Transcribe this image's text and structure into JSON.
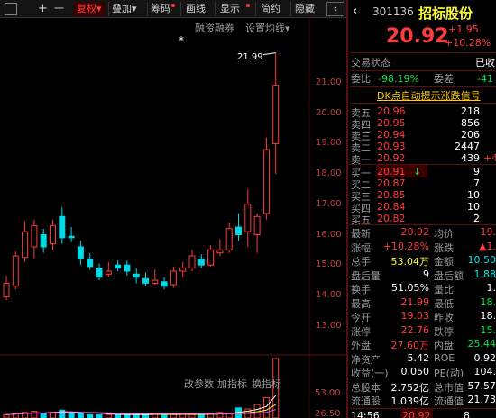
{
  "toolbar": {
    "grid_icon": "grid-icon",
    "plus": "+",
    "minus": "一",
    "fuquan_label": "复权",
    "fuquan_arrow": "▾",
    "diejia_label": "叠加",
    "diejia_arrow": "▾",
    "chouma_label": "筹码",
    "huaxian_label": "画线",
    "xianshi_label": "显示",
    "jianyue_label": "简约",
    "yincang_label": "隐藏"
  },
  "chart_header": {
    "rongzi_label": "融资融券",
    "ma_setting_label": "设置均线",
    "ma_arrow": "▾"
  },
  "price_axis": {
    "ticks": [
      "21.00",
      "20.00",
      "19.00",
      "18.00",
      "17.00",
      "16.00",
      "15.00",
      "14.00",
      "13.00"
    ]
  },
  "high_marker": {
    "value": "21.99",
    "star": "*"
  },
  "indicator_toolbar": {
    "param_label": "改参数",
    "add_label": "加指标",
    "change_label": "换指标"
  },
  "volume_axis": {
    "ticks": [
      "53.00",
      "26.50"
    ]
  },
  "quote": {
    "code": "301136",
    "name": "招标股份",
    "price": "20.92",
    "change": "+1.95",
    "change_pct": "+10.28%",
    "status_label": "交易状态",
    "status_value": "已收",
    "weibi_label": "委比",
    "weibi_value": "-98.19%",
    "weicha_label": "委差",
    "weicha_value": "-41",
    "signal_label": "DK点自动提示涨跌信号",
    "asks": [
      {
        "label": "卖五",
        "price": "20.96",
        "vol": "218",
        "mark": ""
      },
      {
        "label": "卖四",
        "price": "20.95",
        "vol": "856",
        "mark": ""
      },
      {
        "label": "卖三",
        "price": "20.94",
        "vol": "206",
        "mark": ""
      },
      {
        "label": "卖二",
        "price": "20.93",
        "vol": "2447",
        "mark": ""
      },
      {
        "label": "卖一",
        "price": "20.92",
        "vol": "439",
        "mark": "+4"
      }
    ],
    "bids": [
      {
        "label": "买一",
        "price": "20.91",
        "arrow": "↓",
        "vol": "9"
      },
      {
        "label": "买二",
        "price": "20.87",
        "arrow": "",
        "vol": "7"
      },
      {
        "label": "买三",
        "price": "20.85",
        "arrow": "",
        "vol": "10"
      },
      {
        "label": "买四",
        "price": "20.84",
        "arrow": "",
        "vol": "10"
      },
      {
        "label": "买五",
        "price": "20.82",
        "arrow": "",
        "vol": "2"
      }
    ],
    "stats": [
      {
        "l1": "最新",
        "v1": "20.92",
        "c1": "red",
        "l2": "均价",
        "v2": "19.",
        "c2": "red"
      },
      {
        "l1": "涨幅",
        "v1": "+10.28%",
        "c1": "red",
        "l2": "涨跌",
        "v2": "▲1.",
        "c2": "red"
      },
      {
        "l1": "总手",
        "v1": "53.04万",
        "c1": "yel",
        "l2": "金额",
        "v2": "10.50",
        "c2": "cyn"
      },
      {
        "l1": "盘后量",
        "v1": "9",
        "c1": "wht",
        "l2": "盘后额",
        "v2": "1.88",
        "c2": "cyn"
      },
      {
        "l1": "换手",
        "v1": "51.05%",
        "c1": "wht",
        "l2": "量比",
        "v2": "1.",
        "c2": "wht"
      },
      {
        "l1": "最高",
        "v1": "21.99",
        "c1": "red",
        "l2": "最低",
        "v2": "18.",
        "c2": "grn"
      },
      {
        "l1": "今开",
        "v1": "19.03",
        "c1": "red",
        "l2": "昨收",
        "v2": "18.",
        "c2": "wht"
      },
      {
        "l1": "涨停",
        "v1": "22.76",
        "c1": "red",
        "l2": "跌停",
        "v2": "15.",
        "c2": "grn"
      },
      {
        "l1": "外盘",
        "v1": "27.60万",
        "c1": "red",
        "l2": "内盘",
        "v2": "25.44",
        "c2": "grn"
      },
      {
        "l1": "净资产",
        "v1": "5.42",
        "c1": "wht",
        "l2": "ROE",
        "v2": "0.92",
        "c2": "wht"
      },
      {
        "l1": "收益(一)",
        "v1": "0.050",
        "c1": "wht",
        "l2": "PE(动)",
        "v2": "104.",
        "c2": "wht"
      },
      {
        "l1": "总股本",
        "v1": "2.752亿",
        "c1": "wht",
        "l2": "总市值",
        "v2": "57.57",
        "c2": "wht"
      },
      {
        "l1": "流通股",
        "v1": "1.039亿",
        "c1": "wht",
        "l2": "流通值",
        "v2": "21.73",
        "c2": "wht"
      }
    ],
    "tick_time": "14:56",
    "tick_price": "20.92",
    "tick_vol": "8"
  },
  "chart_data": {
    "type": "candlestick",
    "ylim": [
      13.0,
      22.0
    ],
    "candles": [
      {
        "o": 13.95,
        "c": 14.4,
        "h": 14.65,
        "l": 13.85,
        "up": true
      },
      {
        "o": 14.3,
        "c": 15.3,
        "h": 15.45,
        "l": 14.2,
        "up": true
      },
      {
        "o": 15.25,
        "c": 16.1,
        "h": 16.45,
        "l": 15.1,
        "up": true
      },
      {
        "o": 15.6,
        "c": 16.3,
        "h": 16.5,
        "l": 15.2,
        "up": true
      },
      {
        "o": 16.0,
        "c": 15.6,
        "h": 16.2,
        "l": 15.4,
        "up": false
      },
      {
        "o": 15.7,
        "c": 16.3,
        "h": 16.5,
        "l": 15.5,
        "up": true
      },
      {
        "o": 16.6,
        "c": 15.9,
        "h": 16.9,
        "l": 15.7,
        "up": false
      },
      {
        "o": 15.95,
        "c": 15.9,
        "h": 16.25,
        "l": 15.75,
        "up": false
      },
      {
        "o": 15.6,
        "c": 15.2,
        "h": 15.8,
        "l": 15.0,
        "up": false
      },
      {
        "o": 15.2,
        "c": 14.95,
        "h": 15.4,
        "l": 14.85,
        "up": false
      },
      {
        "o": 14.9,
        "c": 14.6,
        "h": 15.05,
        "l": 14.5,
        "up": false
      },
      {
        "o": 14.7,
        "c": 14.8,
        "h": 15.1,
        "l": 14.6,
        "up": true
      },
      {
        "o": 15.0,
        "c": 14.9,
        "h": 15.15,
        "l": 14.8,
        "up": false
      },
      {
        "o": 15.0,
        "c": 14.8,
        "h": 15.15,
        "l": 14.65,
        "up": false
      },
      {
        "o": 14.7,
        "c": 14.6,
        "h": 14.9,
        "l": 14.4,
        "up": false
      },
      {
        "o": 14.55,
        "c": 14.4,
        "h": 14.75,
        "l": 14.3,
        "up": false
      },
      {
        "o": 14.4,
        "c": 14.5,
        "h": 14.85,
        "l": 14.35,
        "up": true
      },
      {
        "o": 14.45,
        "c": 14.3,
        "h": 14.6,
        "l": 14.2,
        "up": false
      },
      {
        "o": 14.35,
        "c": 14.8,
        "h": 14.95,
        "l": 14.25,
        "up": true
      },
      {
        "o": 14.8,
        "c": 14.9,
        "h": 15.1,
        "l": 14.6,
        "up": true
      },
      {
        "o": 14.9,
        "c": 15.3,
        "h": 15.5,
        "l": 14.8,
        "up": true
      },
      {
        "o": 15.2,
        "c": 15.0,
        "h": 15.35,
        "l": 14.9,
        "up": false
      },
      {
        "o": 15.0,
        "c": 15.5,
        "h": 15.65,
        "l": 14.95,
        "up": true
      },
      {
        "o": 15.4,
        "c": 15.5,
        "h": 15.85,
        "l": 15.3,
        "up": true
      },
      {
        "o": 15.5,
        "c": 16.2,
        "h": 16.4,
        "l": 15.4,
        "up": true
      },
      {
        "o": 16.25,
        "c": 16.0,
        "h": 16.7,
        "l": 15.8,
        "up": false
      },
      {
        "o": 16.1,
        "c": 17.0,
        "h": 17.5,
        "l": 15.6,
        "up": true
      },
      {
        "o": 16.0,
        "c": 16.6,
        "h": 16.7,
        "l": 15.4,
        "up": true
      },
      {
        "o": 16.7,
        "c": 18.8,
        "h": 19.2,
        "l": 16.5,
        "up": true
      },
      {
        "o": 19.0,
        "c": 20.92,
        "h": 21.99,
        "l": 18.0,
        "up": true
      }
    ],
    "volumes": [
      3,
      4,
      5,
      6,
      4,
      5,
      7,
      5,
      4,
      3,
      3,
      3,
      3,
      3,
      3,
      3,
      4,
      3,
      3,
      4,
      3,
      3,
      4,
      5,
      4,
      9,
      8,
      12,
      18,
      53
    ]
  }
}
